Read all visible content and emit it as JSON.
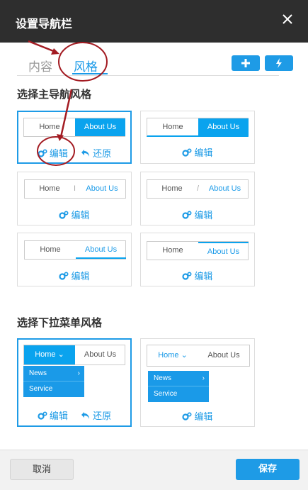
{
  "dialog": {
    "title": "设置导航栏",
    "close_icon": "close-icon"
  },
  "tabs": [
    {
      "label": "内容"
    },
    {
      "label": "风格"
    }
  ],
  "toolbar": {
    "add_icon": "plus-icon",
    "quick_icon": "lightning-icon"
  },
  "sections": {
    "main_nav": "选择主导航风格",
    "dropdown": "选择下拉菜单风格"
  },
  "nav_items": {
    "home": "Home",
    "about": "About Us",
    "divider_bar": "I",
    "divider_slash": "/"
  },
  "dropdown_items": [
    "News",
    "Service"
  ],
  "actions": {
    "edit": "编辑",
    "restore": "还原"
  },
  "footer": {
    "cancel": "取消",
    "save": "保存"
  },
  "colors": {
    "accent": "#1e9be6",
    "annotation": "#a31b22",
    "titlebar": "#2e2e2e"
  }
}
